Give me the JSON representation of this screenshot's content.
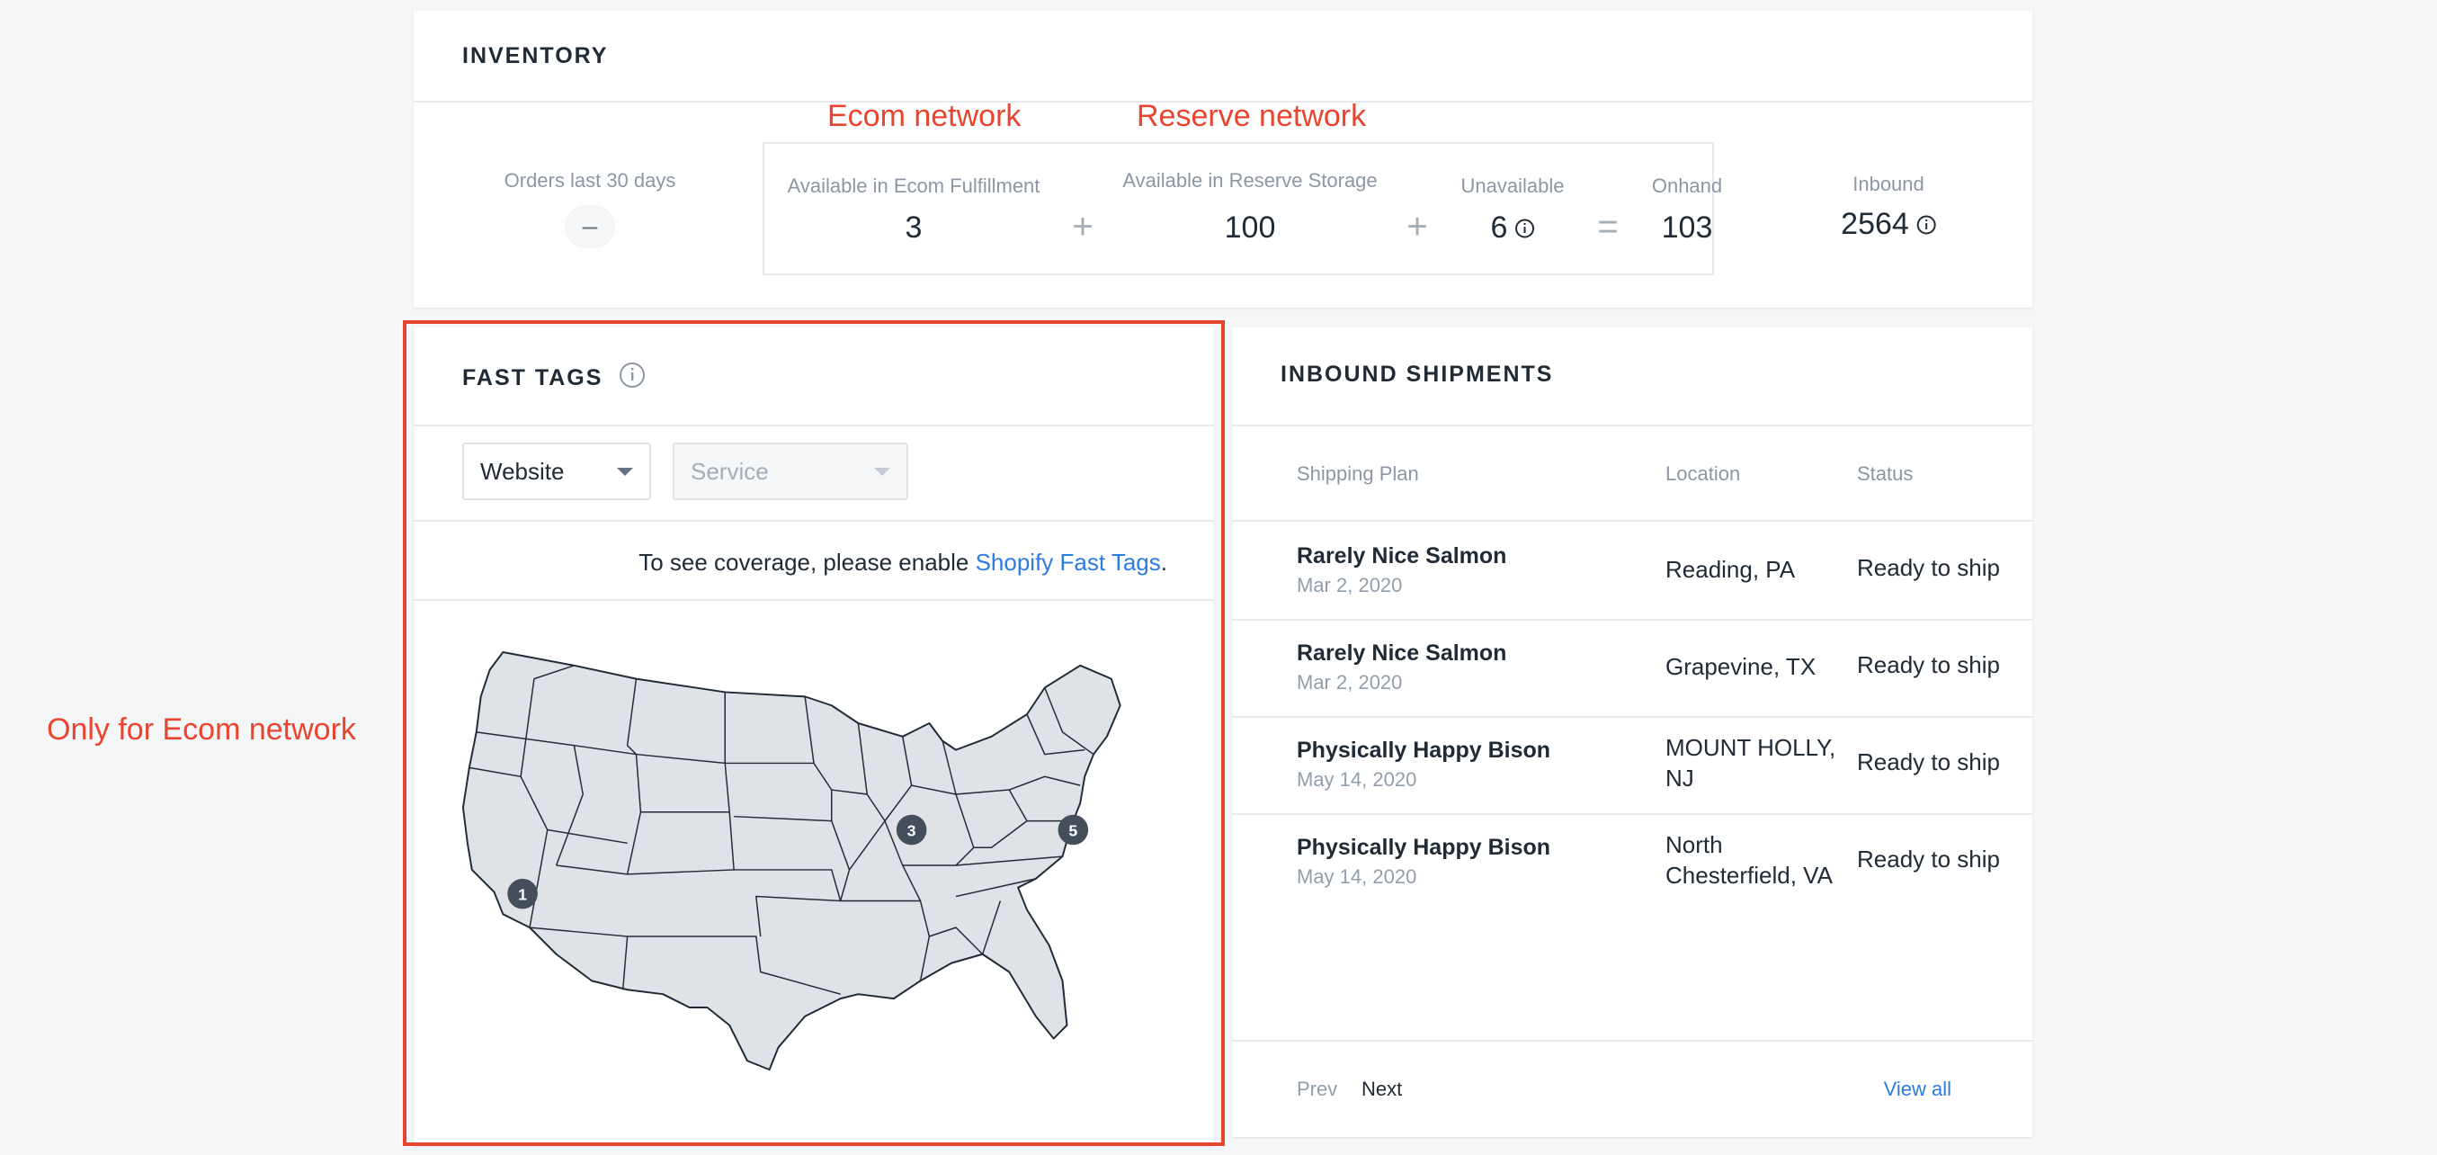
{
  "annotations": {
    "ecom_network": "Ecom network",
    "reserve_network": "Reserve network",
    "only_ecom": "Only for Ecom network"
  },
  "inventory": {
    "title": "INVENTORY",
    "orders_label": "Orders last 30 days",
    "orders_value": "–",
    "available_ecom_label": "Available in Ecom Fulfillment",
    "available_ecom_value": "3",
    "available_reserve_label": "Available in Reserve Storage",
    "available_reserve_value": "100",
    "unavailable_label": "Unavailable",
    "unavailable_value": "6",
    "onhand_label": "Onhand",
    "onhand_value": "103",
    "inbound_label": "Inbound",
    "inbound_value": "2564",
    "plus": "+",
    "equals": "="
  },
  "fast_tags": {
    "title": "FAST TAGS",
    "website_select": "Website",
    "service_select": "Service",
    "coverage_text": "To see coverage, please enable ",
    "coverage_link": "Shopify Fast Tags",
    "coverage_end": ".",
    "markers": [
      "1",
      "3",
      "5"
    ]
  },
  "inbound_shipments": {
    "title": "INBOUND SHIPMENTS",
    "columns": [
      "Shipping Plan",
      "Location",
      "Status"
    ],
    "rows": [
      {
        "plan": "Rarely Nice Salmon",
        "date": "Mar 2, 2020",
        "location": "Reading, PA",
        "status": "Ready to ship"
      },
      {
        "plan": "Rarely Nice Salmon",
        "date": "Mar 2, 2020",
        "location": "Grapevine, TX",
        "status": "Ready to ship"
      },
      {
        "plan": "Physically Happy Bison",
        "date": "May 14, 2020",
        "location": "MOUNT HOLLY, NJ",
        "status": "Ready to ship"
      },
      {
        "plan": "Physically Happy Bison",
        "date": "May 14, 2020",
        "location": "North Chesterfield, VA",
        "status": "Ready to ship"
      }
    ],
    "prev": "Prev",
    "next": "Next",
    "view_all": "View all"
  },
  "colors": {
    "accent": "#2c7be5",
    "annotation": "#e8442e",
    "marker": "#454f5b"
  }
}
